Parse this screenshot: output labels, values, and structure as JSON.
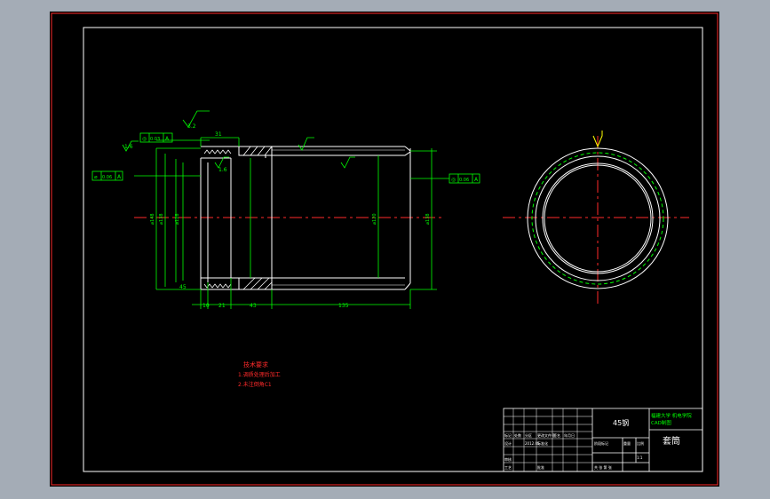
{
  "drawing": {
    "part_name": "套筒",
    "material": "45钢",
    "school": "福建大学 机电学院",
    "school_line2": "CAD制图",
    "surface_marks": [
      "3.2",
      "1.6",
      "1.6"
    ],
    "tolerance_frames": [
      {
        "symbol": "◎",
        "value": "0.03",
        "datum": "A"
      },
      {
        "symbol": "⌀",
        "value": "0.06",
        "datum": "A"
      },
      {
        "symbol": "◎",
        "value": "0.06",
        "datum": "A"
      }
    ],
    "dimensions": {
      "top_length": "31",
      "bottom": [
        "10",
        "21",
        "43",
        "135"
      ],
      "diameters": [
        "⌀148",
        "⌀138",
        "⌀128",
        "⌀120",
        "⌀138"
      ],
      "small_label": "45"
    },
    "notes": {
      "title": "技术要求",
      "line1": "1.调质处理后加工",
      "line2": "2.未注倒角C1"
    },
    "title_block": {
      "row1": [
        "标记",
        "处数",
        "分区",
        "更改文件号",
        "签名",
        "年月日"
      ],
      "designer": "设计",
      "standard": "标准化",
      "date": "2012.05",
      "stage": "阶段标记",
      "weight": "重量",
      "scale": "比例",
      "scale_value": "1:1",
      "check": "审核",
      "process": "工艺",
      "approve": "批准",
      "sheet": "共 张 第 张"
    }
  }
}
